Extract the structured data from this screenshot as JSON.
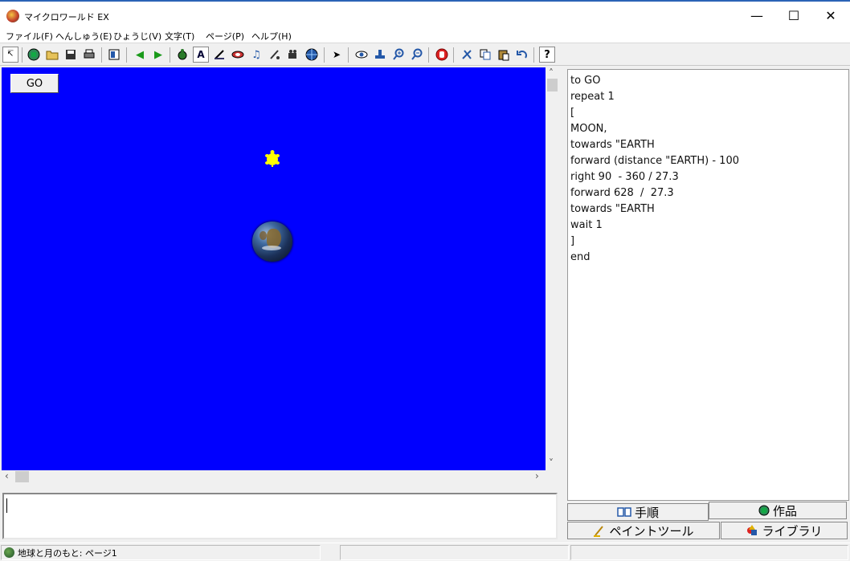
{
  "window": {
    "title": "マイクロワールド EX",
    "minimize": "—",
    "maximize": "☐",
    "close": "✕"
  },
  "menu": [
    "ファイル(F)",
    "へんしゅう(E)",
    "ひょうじ(V)",
    "文字(T)",
    "ページ(P)",
    "ヘルプ(H)"
  ],
  "toolbar": {
    "pointer": "↸",
    "text_icon": "A",
    "help": "?",
    "back": "◀",
    "forward": "▶",
    "music": "♫",
    "cursor": "➤"
  },
  "canvas": {
    "go_label": "GO",
    "background": "#0000ff"
  },
  "procedure": [
    "to GO",
    "repeat 1",
    "[",
    "MOON,",
    "towards \"EARTH",
    "forward (distance \"EARTH) - 100",
    "right 90  - 360 / 27.3",
    "forward 628  /  27.3",
    "towards \"EARTH",
    "wait 1",
    "]",
    "end"
  ],
  "tabs": {
    "steps": "手順",
    "works": "作品",
    "paint": "ペイントツール",
    "library": "ライブラリ"
  },
  "status": {
    "text": "地球と月のもと: ページ1"
  }
}
